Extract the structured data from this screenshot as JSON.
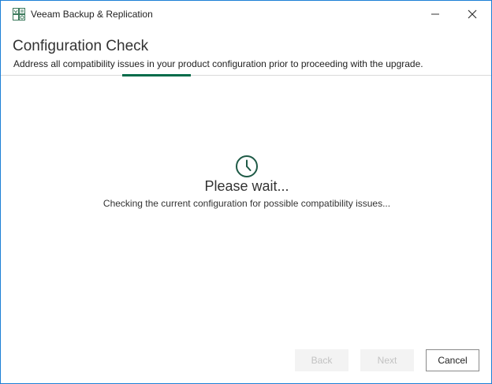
{
  "window": {
    "title": "Veeam Backup & Replication",
    "accent_color": "#1c7fd6",
    "brand_color": "#006b49"
  },
  "header": {
    "title": "Configuration Check",
    "subtitle": "Address all compatibility issues in your product configuration prior to proceeding with the upgrade."
  },
  "status": {
    "icon": "clock-icon",
    "title": "Please wait...",
    "message": "Checking the current configuration for possible compatibility issues..."
  },
  "footer": {
    "back_label": "Back",
    "next_label": "Next",
    "cancel_label": "Cancel"
  }
}
